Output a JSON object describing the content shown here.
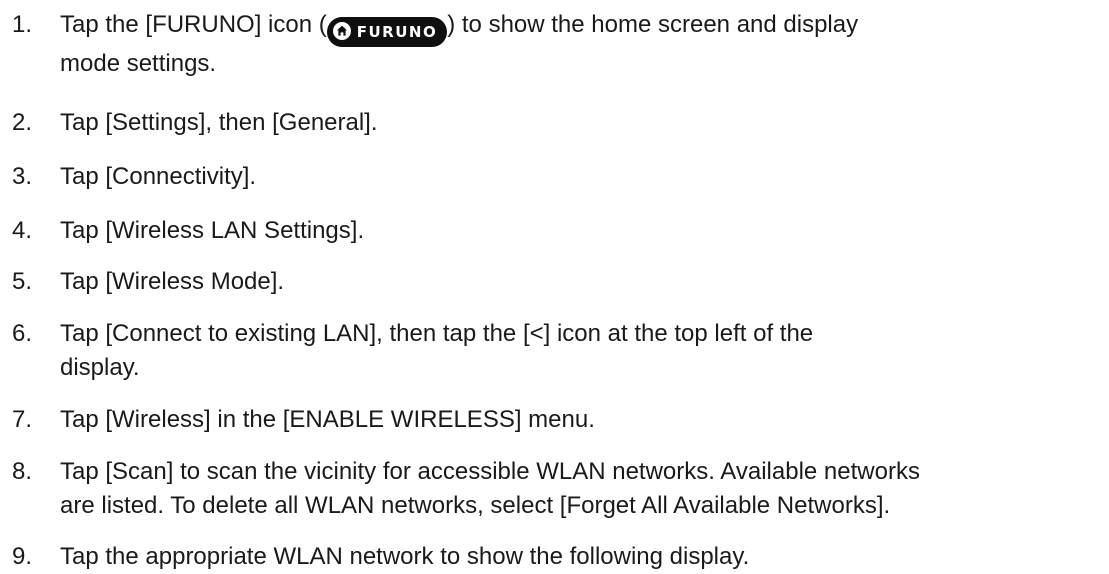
{
  "steps": [
    {
      "number": "1.",
      "text_before_icon": "Tap the [FURUNO] icon (",
      "icon": "furuno-home-icon",
      "icon_label": "FURUNO",
      "text_after_icon": ") to show the home screen and display",
      "continuation": "mode settings."
    },
    {
      "number": "2.",
      "text": "Tap [Settings], then [General]."
    },
    {
      "number": "3.",
      "text": "Tap [Connectivity]."
    },
    {
      "number": "4.",
      "text": "Tap [Wireless LAN Settings]."
    },
    {
      "number": "5.",
      "text": "Tap [Wireless Mode]."
    },
    {
      "number": "6.",
      "line1": "Tap [Connect to existing LAN], then tap the [<] icon at the top left of the",
      "line2": "display."
    },
    {
      "number": "7.",
      "text": "Tap [Wireless] in the [ENABLE WIRELESS] menu."
    },
    {
      "number": "8.",
      "line1": "Tap [Scan] to scan the vicinity for accessible WLAN networks. Available networks",
      "line2": "are listed. To delete all WLAN networks, select [Forget All Available Networks]."
    },
    {
      "number": "9.",
      "text": "Tap the appropriate WLAN network to show the following display."
    }
  ],
  "colors": {
    "text": "#1a1a1a",
    "badge_background": "#0f0f0f",
    "badge_text": "#ffffff"
  }
}
